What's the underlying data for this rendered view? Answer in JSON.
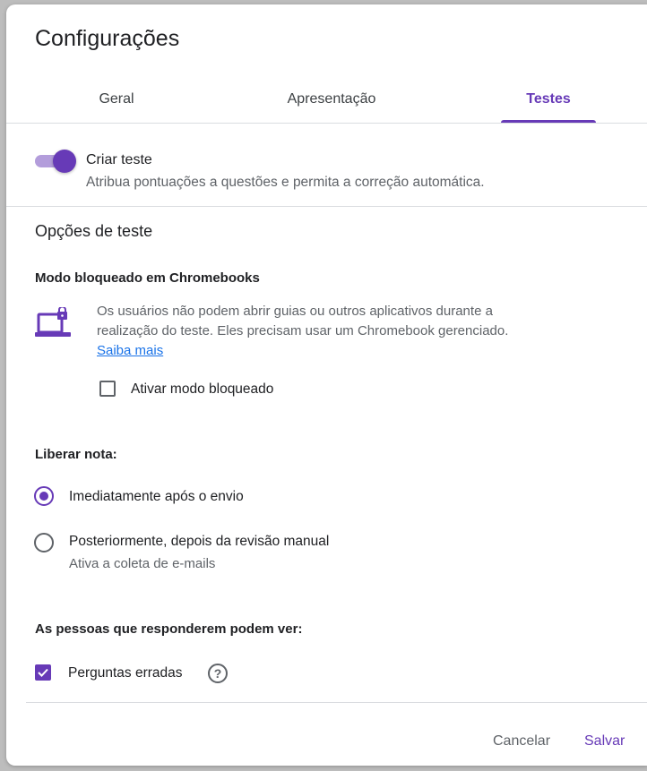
{
  "dialog": {
    "title": "Configurações",
    "tabs": [
      {
        "label": "Geral",
        "active": false
      },
      {
        "label": "Apresentação",
        "active": false
      },
      {
        "label": "Testes",
        "active": true
      }
    ]
  },
  "quiz_toggle": {
    "label": "Criar teste",
    "description": "Atribua pontuações a questões e permita a correção automática.",
    "enabled": true
  },
  "quiz_options": {
    "heading": "Opções de teste",
    "locked_mode": {
      "heading": "Modo bloqueado em Chromebooks",
      "icon": "laptop-lock-icon",
      "description_line1": "Os usuários não podem abrir guias ou outros aplicativos durante a",
      "description_line2": "realização do teste. Eles precisam usar um Chromebook gerenciado.",
      "learn_more": "Saiba mais",
      "checkbox_label": "Ativar modo bloqueado",
      "checked": false
    },
    "release_grade": {
      "heading": "Liberar nota:",
      "options": [
        {
          "label": "Imediatamente após o envio",
          "selected": true,
          "sublabel": ""
        },
        {
          "label": "Posteriormente, depois da revisão manual",
          "selected": false,
          "sublabel": "Ativa a coleta de e-mails"
        }
      ]
    },
    "respondents_can_see": {
      "heading": "As pessoas que responderem podem ver:",
      "items": [
        {
          "label": "Perguntas erradas",
          "checked": true,
          "help_icon": "?"
        }
      ]
    }
  },
  "footer": {
    "cancel_label": "Cancelar",
    "save_label": "Salvar"
  },
  "colors": {
    "accent": "#673ab7",
    "accent_light": "#b39ddb",
    "link": "#1a73e8",
    "text": "#202124",
    "muted": "#5f6368"
  }
}
